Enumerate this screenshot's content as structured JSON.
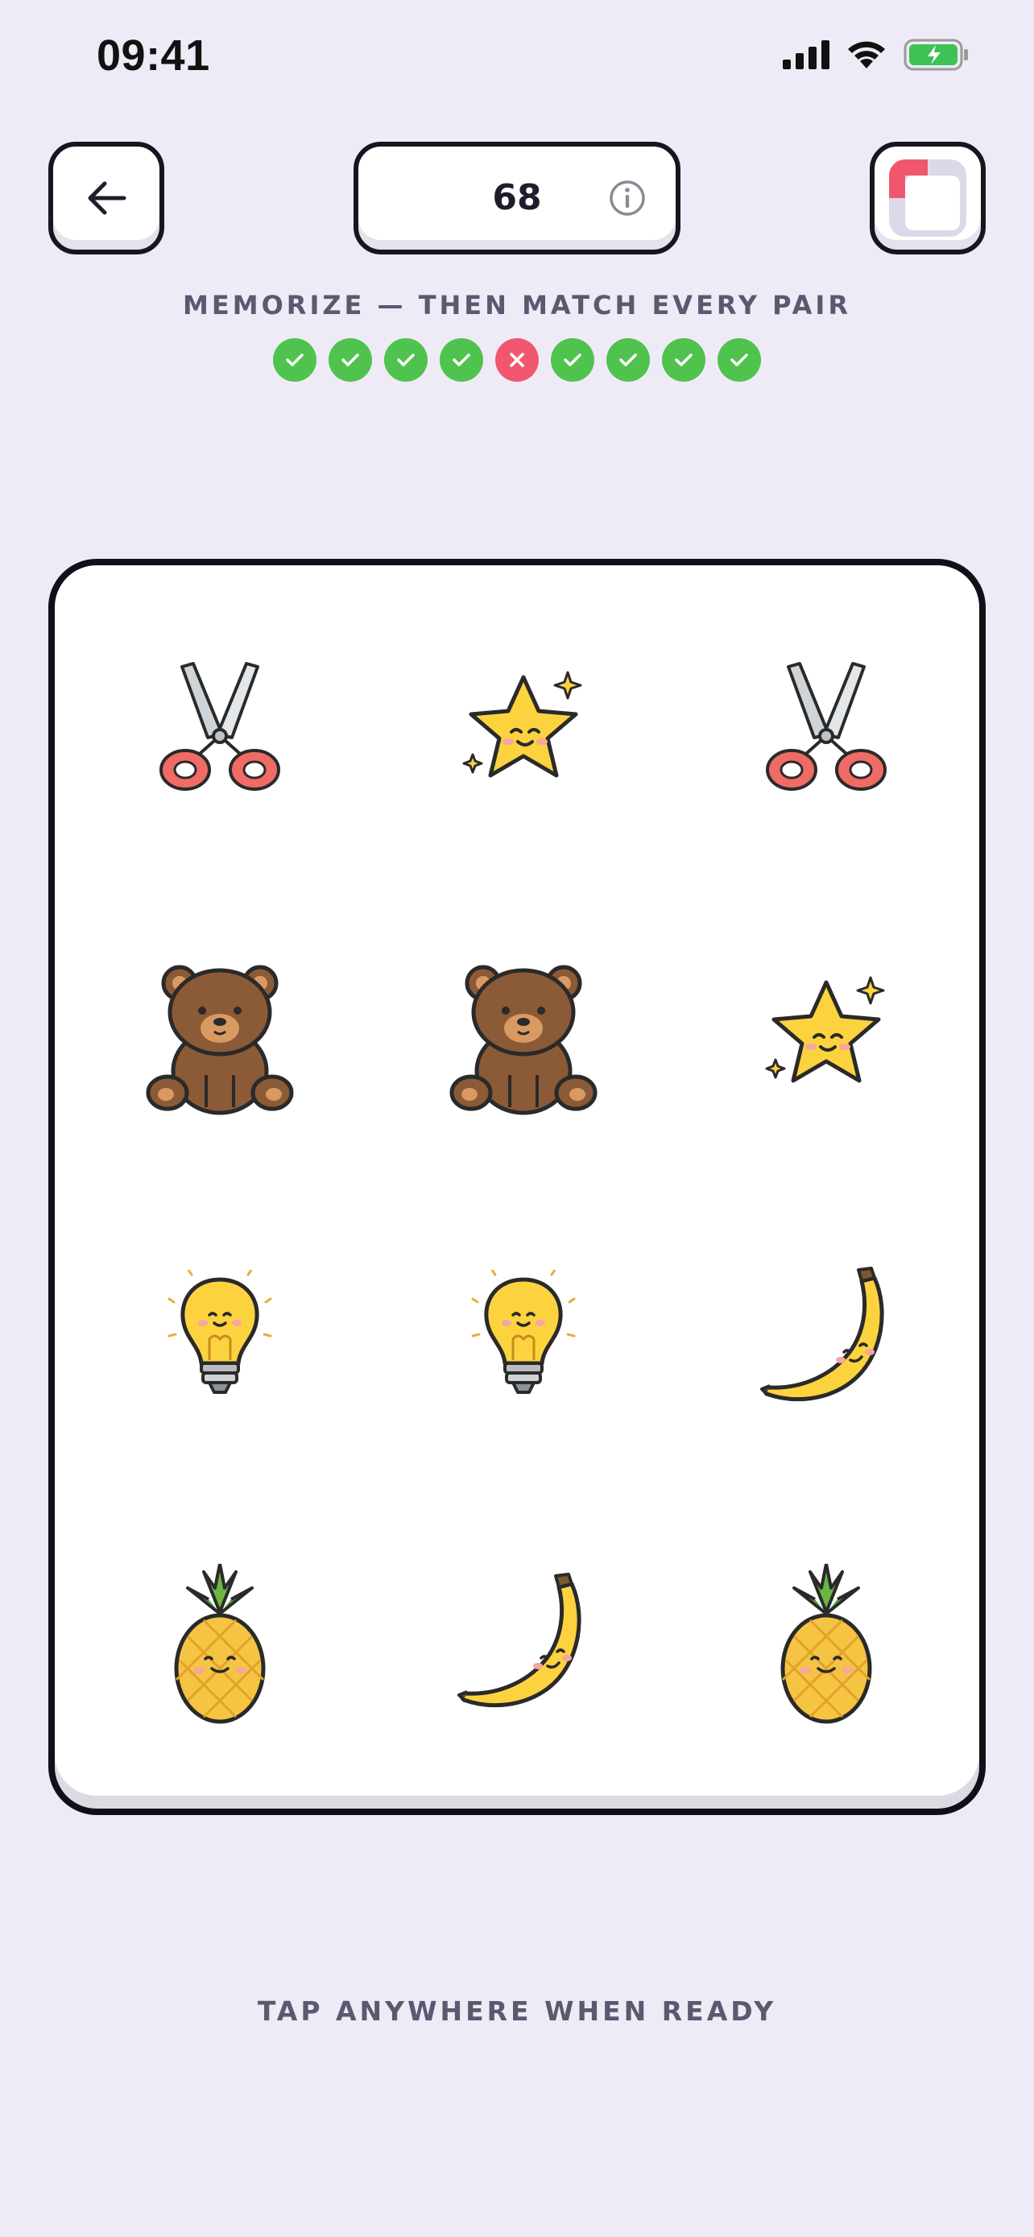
{
  "status_bar": {
    "time": "09:41"
  },
  "header": {
    "score": "68"
  },
  "instruction": "MEMORIZE — THEN MATCH EVERY PAIR",
  "progress": [
    "correct",
    "correct",
    "correct",
    "correct",
    "wrong",
    "correct",
    "correct",
    "correct",
    "correct"
  ],
  "board": {
    "cards": [
      {
        "icon": "scissors-icon"
      },
      {
        "icon": "star-icon"
      },
      {
        "icon": "scissors-icon"
      },
      {
        "icon": "bear-icon"
      },
      {
        "icon": "bear-icon"
      },
      {
        "icon": "star-icon"
      },
      {
        "icon": "lightbulb-icon"
      },
      {
        "icon": "lightbulb-icon"
      },
      {
        "icon": "banana-icon"
      },
      {
        "icon": "pineapple-icon"
      },
      {
        "icon": "banana-icon"
      },
      {
        "icon": "pineapple-icon"
      }
    ]
  },
  "footer_hint": "TAP ANYWHERE WHEN READY",
  "colors": {
    "background": "#eeebf6",
    "correct": "#4fc34e",
    "wrong": "#f0576f",
    "accent": "#f0576f"
  }
}
